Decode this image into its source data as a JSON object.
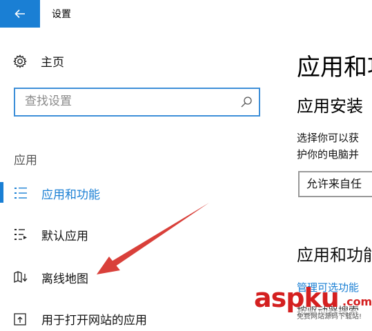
{
  "titlebar": {
    "title": "设置"
  },
  "sidebar": {
    "home_label": "主页",
    "search": {
      "placeholder": "查找设置"
    },
    "section_label": "应用",
    "items": [
      {
        "label": "应用和功能",
        "icon": "apps-features-icon",
        "active": true
      },
      {
        "label": "默认应用",
        "icon": "default-apps-icon",
        "active": false
      },
      {
        "label": "离线地图",
        "icon": "offline-maps-icon",
        "active": false
      },
      {
        "label": "用于打开网站的应用",
        "icon": "apps-for-websites-icon",
        "active": false
      }
    ]
  },
  "main": {
    "title": "应用和功",
    "subtitle": "应用安装",
    "desc_line1": "选择你可以获",
    "desc_line2": "护你的电脑并",
    "dropdown_value": "允许来自任",
    "subtitle2": "应用和功能",
    "link": "管理可选功能",
    "partial_text": "按驱动器搜索"
  },
  "watermark": {
    "brand": "aspku",
    "tld": ".com",
    "tagline": "免费网站源码下载站!"
  },
  "colors": {
    "accent": "#1a7fd4",
    "arrow": "#d9403a",
    "watermark": "#d42020"
  }
}
